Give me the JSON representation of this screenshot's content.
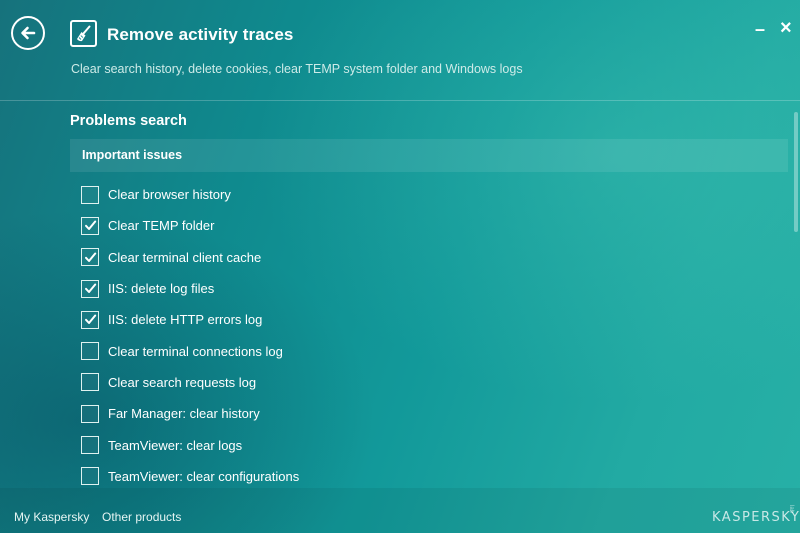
{
  "header": {
    "title": "Remove activity traces",
    "subtitle": "Clear search history, delete cookies, clear TEMP system folder and Windows logs",
    "minimize_label": "–",
    "close_label": "×"
  },
  "section": {
    "title": "Problems search",
    "group_title": "Important issues"
  },
  "options": [
    {
      "label": "Clear browser history",
      "checked": false
    },
    {
      "label": "Clear TEMP folder",
      "checked": true
    },
    {
      "label": "Clear terminal client cache",
      "checked": true
    },
    {
      "label": "IIS: delete log files",
      "checked": true
    },
    {
      "label": "IIS: delete HTTP errors log",
      "checked": true
    },
    {
      "label": "Clear terminal connections log",
      "checked": false
    },
    {
      "label": "Clear search requests log",
      "checked": false
    },
    {
      "label": "Far Manager: clear history",
      "checked": false
    },
    {
      "label": "TeamViewer: clear logs",
      "checked": false
    },
    {
      "label": "TeamViewer: clear configurations",
      "checked": false
    }
  ],
  "footer": {
    "my_kaspersky": "My Kaspersky",
    "other_products": "Other products",
    "brand": "KASPERSKY",
    "brand_suffix": "lab"
  },
  "icons": {
    "back": "back-arrow-icon",
    "title": "broom-icon"
  }
}
